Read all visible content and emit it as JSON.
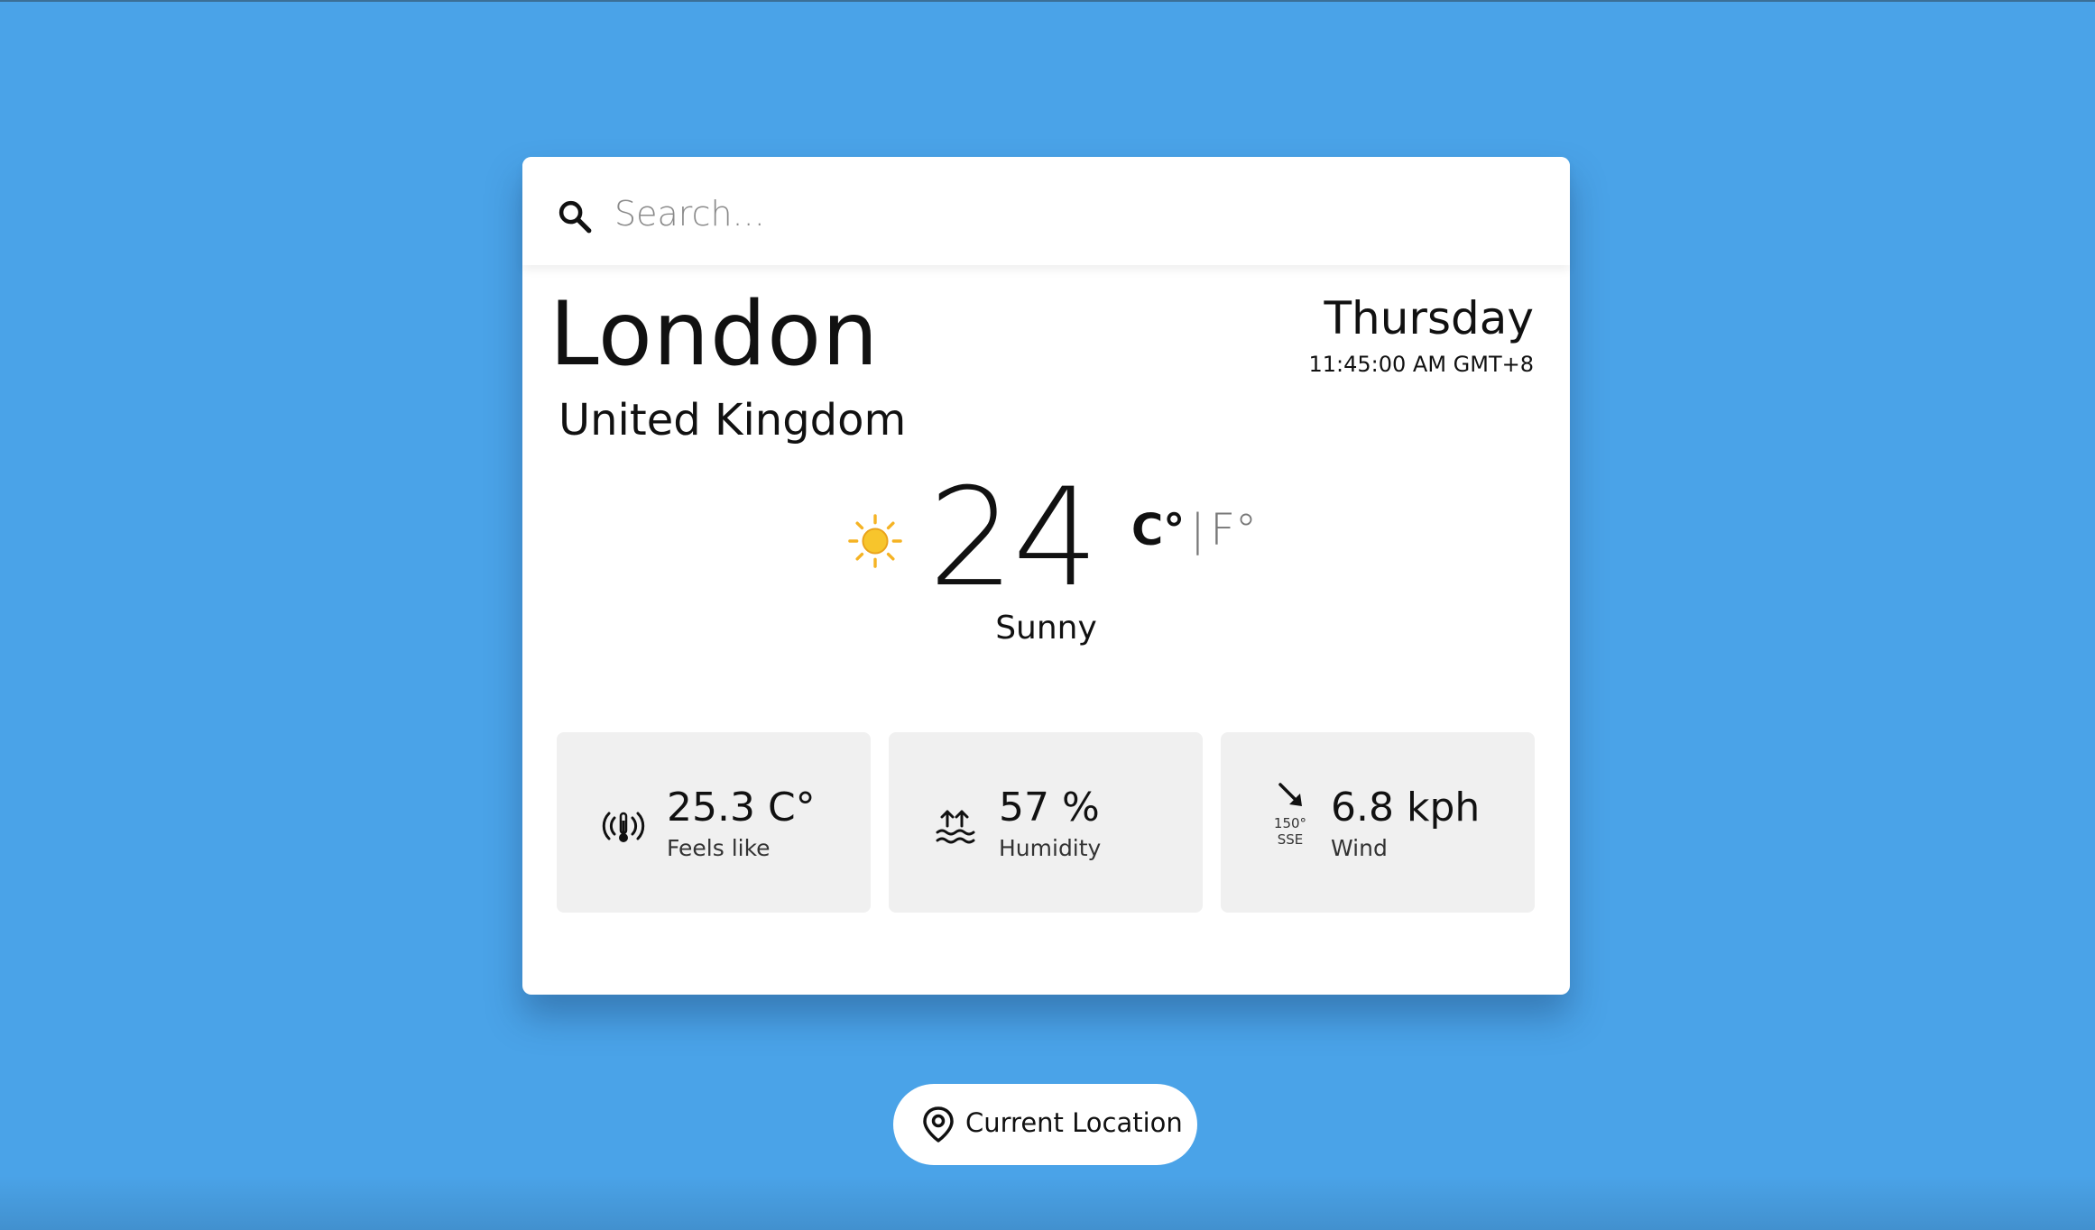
{
  "search": {
    "placeholder": "Search...",
    "icon": "search-icon"
  },
  "location": {
    "city": "London",
    "country": "United Kingdom"
  },
  "datetime": {
    "day": "Thursday",
    "time": "11:45:00 AM GMT+8"
  },
  "current": {
    "icon": "sun-icon",
    "temperature": "24",
    "unit_celsius": "C°",
    "unit_separator": "|",
    "unit_fahrenheit": "F°",
    "selected_unit": "C",
    "condition": "Sunny"
  },
  "stats": {
    "feels_like": {
      "value": "25.3 C°",
      "label": "Feels like",
      "icon": "thermometer-icon"
    },
    "humidity": {
      "value": "57 %",
      "label": "Humidity",
      "icon": "humidity-icon"
    },
    "wind": {
      "value": "6.8 kph",
      "label": "Wind",
      "degree": "150°",
      "direction": "SSE",
      "icon": "wind-arrow-icon"
    }
  },
  "current_location": {
    "label": "Current Location",
    "icon": "location-pin-icon"
  },
  "colors": {
    "background": "#4aa3e8",
    "card": "#ffffff",
    "stat_tile": "#f0f0f0",
    "sun": "#f5b324"
  }
}
